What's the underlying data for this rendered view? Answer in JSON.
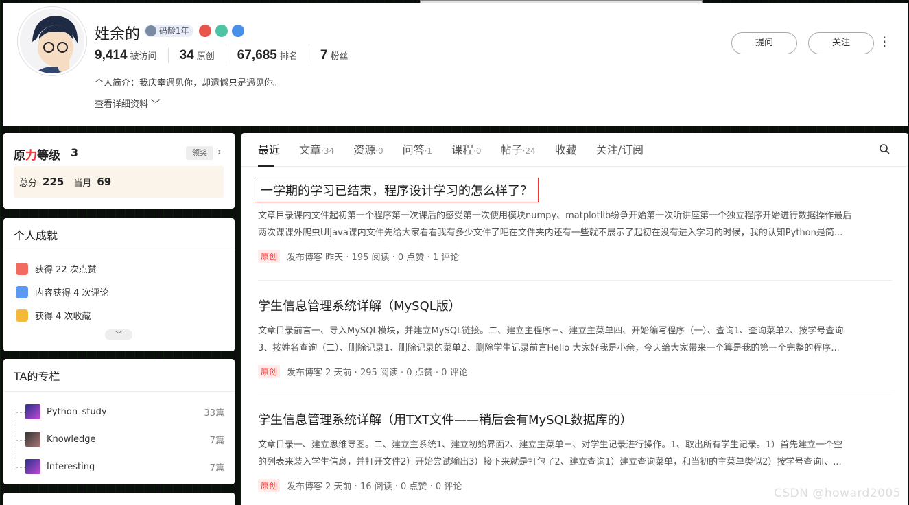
{
  "profile": {
    "name": "姓余的",
    "code_age": "码龄1年",
    "stats": [
      {
        "value": "9,414",
        "label": "被访问"
      },
      {
        "value": "34",
        "label": "原创"
      },
      {
        "value": "67,685",
        "label": "排名"
      },
      {
        "value": "7",
        "label": "粉丝"
      }
    ],
    "intro": "个人简介：我庆幸遇见你，却遗憾只是遇见你。",
    "more": "查看详细资料",
    "ask_button": "提问",
    "follow_button": "关注"
  },
  "level": {
    "title_a": "原",
    "title_b": "力",
    "title_c": "等级",
    "value": "3",
    "award": "领奖",
    "total_label": "总分",
    "total": "225",
    "month_label": "当月",
    "month": "69"
  },
  "achievements": {
    "title": "个人成就",
    "items": [
      "获得 22 次点赞",
      "内容获得 4 次评论",
      "获得 4 次收藏"
    ]
  },
  "columns": {
    "title": "TA的专栏",
    "items": [
      {
        "name": "Python_study",
        "count": "33篇"
      },
      {
        "name": "Knowledge",
        "count": "7篇"
      },
      {
        "name": "Interesting",
        "count": "7篇"
      }
    ]
  },
  "tabs": [
    {
      "label": "最近",
      "count": ""
    },
    {
      "label": "文章",
      "count": "·34"
    },
    {
      "label": "资源",
      "count": "·0"
    },
    {
      "label": "问答",
      "count": "·1"
    },
    {
      "label": "课程",
      "count": "·0"
    },
    {
      "label": "帖子",
      "count": "·24"
    },
    {
      "label": "收藏",
      "count": ""
    },
    {
      "label": "关注/订阅",
      "count": ""
    }
  ],
  "articles": [
    {
      "title": "一学期的学习已结束，程序设计学习的怎么样了？",
      "desc1": "文章目录课内文件起初第一个程序第一次课后的感受第一次使用模块numpy、matplotlib纷争开始第一次听讲座第一个独立程序开始进行数据操作最后",
      "desc2": "两次课课外爬虫UIJava课内文件先给大家看看我有多少文件了吧在文件夹内还有一些就不展示了起初在没有进入学习的时候，我的认知Python是简...",
      "tag": "原创",
      "meta": "发布博客 昨天 ·   195 阅读 ·   0 点赞 ·   1 评论"
    },
    {
      "title": "学生信息管理系统详解（MySQL版）",
      "desc1": "文章目录前言一、导入MySQL模块，并建立MySQL链接。二、建立主程序三、建立主菜单四、开始编写程序（一）、查询1、查询菜单2、按学号查询",
      "desc2": "3、按姓名查询（二）、删除记录1、删除记录的菜单2、删除学生记录前言Hello 大家好我是小余，今天给大家带来一个算是我的第一个完整的程序...",
      "tag": "原创",
      "meta": "发布博客 2 天前 ·   295 阅读 ·   0 点赞 ·   0 评论"
    },
    {
      "title": "学生信息管理系统详解（用TXT文件——稍后会有MySQL数据库的）",
      "desc1": "文章目录一、建立思维导图。二、建立主系统1、建立初始界面2、建立主菜单三、对学生记录进行操作。1、取出所有学生记录。1）首先建立一个空",
      "desc2": "的列表来装入学生信息，并打开文件2）开始尝试输出3）接下来就是打包了2、建立查询1）建立查询菜单，和当初的主菜单类似2）按学号查询Ⅰ、...",
      "tag": "原创",
      "meta": "发布博客 2 天前 ·   16 阅读 ·   0 点赞 ·   0 评论"
    }
  ],
  "watermark": "CSDN @howard2005"
}
